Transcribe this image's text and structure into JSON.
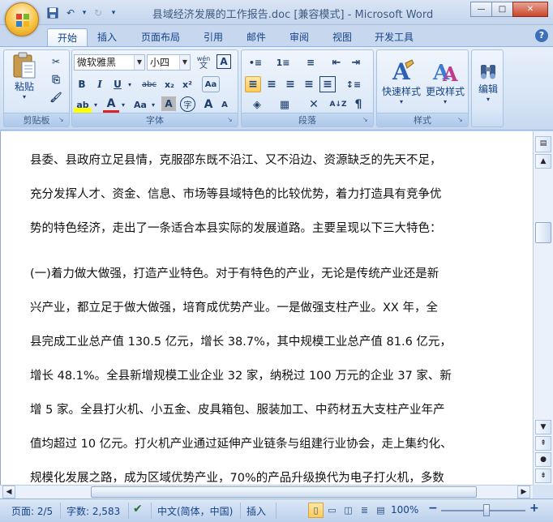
{
  "window": {
    "title": "县域经济发展的工作报告.doc [兼容模式] - Microsoft Word",
    "minimize": "—",
    "maximize": "□",
    "close": "✕"
  },
  "qat": {
    "save_icon": "floppy-disk",
    "undo": "↶",
    "undo_drop": "▾",
    "redo": "↻",
    "customize": "▾"
  },
  "tabs": [
    "开始",
    "插入",
    "页面布局",
    "引用",
    "邮件",
    "审阅",
    "视图",
    "开发工具"
  ],
  "active_tab": "开始",
  "help": "?",
  "ribbon": {
    "clipboard": {
      "label": "剪贴板",
      "paste": "粘贴",
      "paste_drop": "▾",
      "cut": "✂",
      "copy": "⎘",
      "format_painter": "🖌"
    },
    "font": {
      "label": "字体",
      "font_name": "微软雅黑",
      "font_size": "小四",
      "phonetic": "wén",
      "char_border": "A",
      "bold": "B",
      "italic": "I",
      "underline": "U",
      "strikethrough": "abc",
      "subscript": "x₂",
      "superscript": "x²",
      "clear_format": "Aa",
      "highlight": "ab",
      "font_color": "A",
      "change_case": "Aa",
      "char_shading": "A",
      "enclose": "字",
      "grow": "A",
      "shrink": "A"
    },
    "paragraph": {
      "label": "段落",
      "bullets": "•≡",
      "numbering": "1≡",
      "multilevel": "≡",
      "dec_indent": "⇤",
      "inc_indent": "⇥",
      "align_left": "≡",
      "center": "≡",
      "align_right": "≡",
      "justify": "≡",
      "distributed": "≡",
      "line_spacing": "↕≡",
      "shading": "◈",
      "borders": "▦",
      "chinese_layout": "✕",
      "sort": "A↓Z",
      "show_marks": "¶"
    },
    "styles": {
      "label": "样式",
      "quick_styles": "快速样式",
      "change_styles": "更改样式"
    },
    "editing": {
      "label": "编辑"
    }
  },
  "document": {
    "lines": [
      "县委、县政府立足县情，克服邵东既不沿江、又不沿边、资源缺乏的先天不足，",
      "充分发挥人才、资金、信息、市场等县域特色的比较优势，着力打造具有竞争优",
      "势的特色经济，走出了一条适合本县实际的发展道路。主要呈现以下三大特色：",
      "",
      "(一)着力做大做强，打造产业特色。对于有特色的产业，无论是传统产业还是新",
      "兴产业，都立足于做大做强，培育成优势产业。一是做强支柱产业。XX 年，全",
      "县完成工业总产值 130.5 亿元，增长 38.7%，其中规模工业总产值 81.6 亿元，",
      "增长 48.1%。全县新增规模工业企业 32 家，纳税过 100 万元的企业 37 家、新",
      "增 5 家。全县打火机、小五金、皮具箱包、服装加工、中药材五大支柱产业年产",
      "值均超过 10 亿元。打火机产业通过延伸产业链条与组建行业协会，走上集约化、",
      "规模化发展之路，成为区域优势产业，70%的产品升级换代为电子打火机，多数"
    ]
  },
  "scroll": {
    "up": "▲",
    "down": "▼",
    "left": "◀",
    "right": "▶",
    "prev_page": "⇞",
    "next_page": "⇟",
    "browse": "●"
  },
  "statusbar": {
    "page": "页面: 2/5",
    "words": "字数: 2,583",
    "language": "中文(简体，中国)",
    "mode": "插入",
    "zoom": "100%",
    "zoom_minus": "−",
    "zoom_plus": "+"
  }
}
